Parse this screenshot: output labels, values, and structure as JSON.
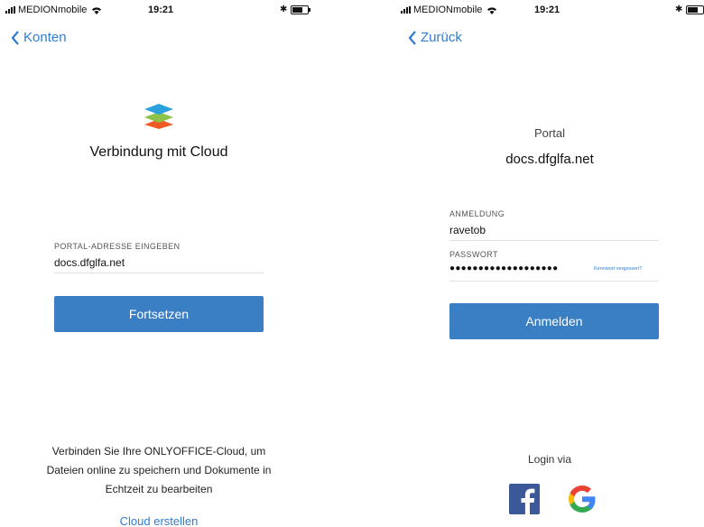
{
  "status_bar_left": {
    "carrier": "MEDIONmobile",
    "time": "19:21"
  },
  "status_bar_right": {
    "carrier": "MEDIONmobile",
    "time": "19:21"
  },
  "connect_screen": {
    "back_label": "Konten",
    "title": "Verbindung mit Cloud",
    "portal_field_label": "PORTAL-ADRESSE EINGEBEN",
    "portal_field_value": "docs.dfglfa.net",
    "continue_button": "Fortsetzen",
    "info_text": "Verbinden Sie Ihre ONLYOFFICE-Cloud, um Dateien online zu speichern und Dokumente in Echtzeit zu bearbeiten",
    "create_cloud_link": "Cloud erstellen"
  },
  "login_screen": {
    "back_label": "Zurück",
    "portal_label": "Portal",
    "portal_url": "docs.dfglfa.net",
    "login_label": "ANMELDUNG",
    "login_value": "ravetob",
    "password_label": "PASSWORT",
    "password_value": "●●●●●●●●●●●●●●●●●●●",
    "forgot_link": "Kennwort vergessen?",
    "login_button": "Anmelden",
    "login_via": "Login via",
    "social": [
      "facebook-icon",
      "google-icon"
    ]
  },
  "colors": {
    "accent": "#3a7fc4",
    "link": "#2f7dd3",
    "logo_blue": "#2aa0dc",
    "logo_green": "#8bc34a",
    "logo_red": "#f15a24",
    "facebook": "#3b5998"
  }
}
